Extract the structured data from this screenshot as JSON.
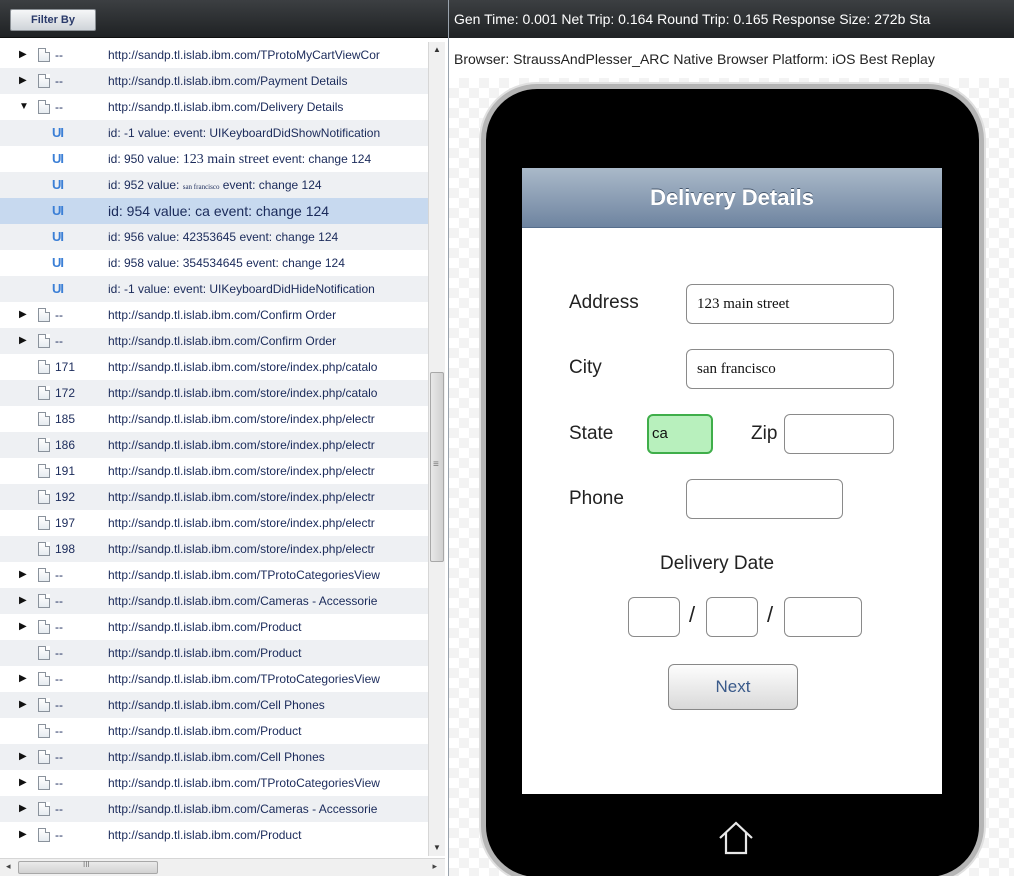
{
  "left_panel": {
    "filter_button": "Filter By",
    "rows": [
      {
        "expander": "collapsed",
        "icon": "doc",
        "id": "--",
        "text": "http://sandp.tl.islab.ibm.com/TProtoMyCartViewCor"
      },
      {
        "expander": "collapsed",
        "icon": "doc",
        "id": "--",
        "text": "http://sandp.tl.islab.ibm.com/Payment Details"
      },
      {
        "expander": "expanded",
        "icon": "doc",
        "id": "--",
        "text": "http://sandp.tl.islab.ibm.com/Delivery Details"
      },
      {
        "expander": "none",
        "icon": "ui",
        "id": "UI",
        "text": "id: -1 value: event: UIKeyboardDidShowNotification"
      },
      {
        "expander": "none",
        "icon": "ui",
        "id": "UI",
        "text_parts": [
          "id: 950 value: ",
          "123 main street",
          " event: change 124"
        ]
      },
      {
        "expander": "none",
        "icon": "ui",
        "id": "UI",
        "text_parts": [
          "id: 952 value: ",
          "san francisco",
          " event: change 124"
        ]
      },
      {
        "expander": "none",
        "icon": "ui",
        "id": "UI",
        "text": "id: 954 value: ca event: change 124",
        "selected": true
      },
      {
        "expander": "none",
        "icon": "ui",
        "id": "UI",
        "text": "id: 956 value: 42353645 event: change 124"
      },
      {
        "expander": "none",
        "icon": "ui",
        "id": "UI",
        "text": "id: 958 value: 354534645 event: change 124"
      },
      {
        "expander": "none",
        "icon": "ui",
        "id": "UI",
        "text": "id: -1 value: event: UIKeyboardDidHideNotification"
      },
      {
        "expander": "collapsed",
        "icon": "doc",
        "id": "--",
        "text": "http://sandp.tl.islab.ibm.com/Confirm Order"
      },
      {
        "expander": "collapsed",
        "icon": "doc",
        "id": "--",
        "text": "http://sandp.tl.islab.ibm.com/Confirm Order"
      },
      {
        "expander": "none",
        "icon": "doc",
        "id": "171",
        "text": "http://sandp.tl.islab.ibm.com/store/index.php/catalo"
      },
      {
        "expander": "none",
        "icon": "doc",
        "id": "172",
        "text": "http://sandp.tl.islab.ibm.com/store/index.php/catalo"
      },
      {
        "expander": "none",
        "icon": "doc",
        "id": "185",
        "text": "http://sandp.tl.islab.ibm.com/store/index.php/electr"
      },
      {
        "expander": "none",
        "icon": "doc",
        "id": "186",
        "text": "http://sandp.tl.islab.ibm.com/store/index.php/electr"
      },
      {
        "expander": "none",
        "icon": "doc",
        "id": "191",
        "text": "http://sandp.tl.islab.ibm.com/store/index.php/electr"
      },
      {
        "expander": "none",
        "icon": "doc",
        "id": "192",
        "text": "http://sandp.tl.islab.ibm.com/store/index.php/electr"
      },
      {
        "expander": "none",
        "icon": "doc",
        "id": "197",
        "text": "http://sandp.tl.islab.ibm.com/store/index.php/electr"
      },
      {
        "expander": "none",
        "icon": "doc",
        "id": "198",
        "text": "http://sandp.tl.islab.ibm.com/store/index.php/electr"
      },
      {
        "expander": "collapsed",
        "icon": "doc",
        "id": "--",
        "text": "http://sandp.tl.islab.ibm.com/TProtoCategoriesView"
      },
      {
        "expander": "collapsed",
        "icon": "doc",
        "id": "--",
        "text": "http://sandp.tl.islab.ibm.com/Cameras - Accessorie"
      },
      {
        "expander": "collapsed",
        "icon": "doc",
        "id": "--",
        "text": "http://sandp.tl.islab.ibm.com/Product"
      },
      {
        "expander": "none",
        "icon": "doc",
        "id": "--",
        "text": "http://sandp.tl.islab.ibm.com/Product"
      },
      {
        "expander": "collapsed",
        "icon": "doc",
        "id": "--",
        "text": "http://sandp.tl.islab.ibm.com/TProtoCategoriesView"
      },
      {
        "expander": "collapsed",
        "icon": "doc",
        "id": "--",
        "text": "http://sandp.tl.islab.ibm.com/Cell Phones"
      },
      {
        "expander": "none",
        "icon": "doc",
        "id": "--",
        "text": "http://sandp.tl.islab.ibm.com/Product"
      },
      {
        "expander": "collapsed",
        "icon": "doc",
        "id": "--",
        "text": "http://sandp.tl.islab.ibm.com/Cell Phones"
      },
      {
        "expander": "collapsed",
        "icon": "doc",
        "id": "--",
        "text": "http://sandp.tl.islab.ibm.com/TProtoCategoriesView"
      },
      {
        "expander": "collapsed",
        "icon": "doc",
        "id": "--",
        "text": "http://sandp.tl.islab.ibm.com/Cameras - Accessorie"
      },
      {
        "expander": "collapsed",
        "icon": "doc",
        "id": "--",
        "text": "http://sandp.tl.islab.ibm.com/Product"
      }
    ]
  },
  "right_panel": {
    "stats": "Gen Time: 0.001  Net Trip: 0.164  Round Trip: 0.165  Response Size: 272b  Sta",
    "browser_info": "Browser: StraussAndPlesser_ARC Native  Browser Platform: iOS  Best Replay",
    "device": {
      "nav_title": "Delivery Details",
      "address_label": "Address",
      "address_value": "123 main street",
      "city_label": "City",
      "city_value": "san francisco",
      "state_label": "State",
      "state_value": "ca",
      "zip_label": "Zip",
      "zip_value": "",
      "phone_label": "Phone",
      "phone_value": "",
      "delivery_date_label": "Delivery Date",
      "date_separator": "/",
      "date_month": "",
      "date_day": "",
      "date_year": "",
      "next_button": "Next"
    }
  },
  "colors": {
    "header_bar": "#2b2e31",
    "selected_row": "#c7d9ef",
    "ui_icon": "#3b7fd6",
    "nav_bar": "#8da0b8",
    "active_field": "#b8f0bd"
  }
}
